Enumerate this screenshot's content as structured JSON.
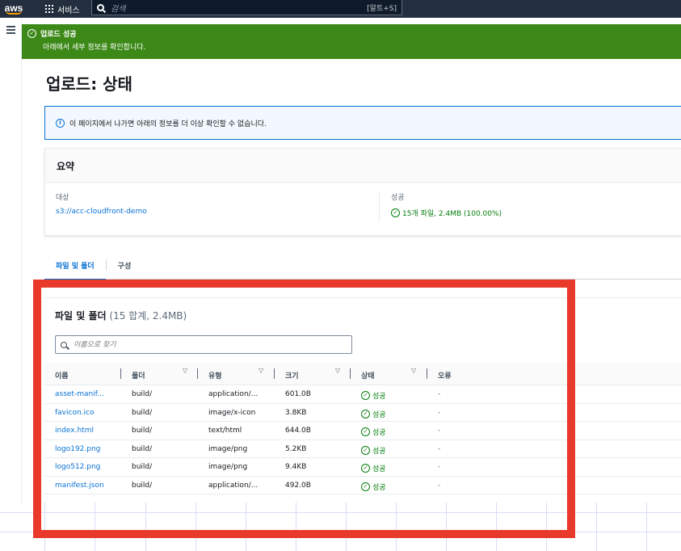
{
  "topbar": {
    "logo": "aws",
    "services_label": "서비스",
    "search_placeholder": "검색",
    "search_shortcut": "[알트+S]"
  },
  "flash": {
    "title": "업로드 성공",
    "message": "아래에서 세부 정보를 확인합니다.",
    "color": "#3c8918"
  },
  "page": {
    "title": "업로드: 상태"
  },
  "info": {
    "message": "이 페이지에서 나가면 아래의 정보를 더 이상 확인할 수 없습니다."
  },
  "summary": {
    "heading": "요약",
    "destination_label": "대상",
    "destination_value": "s3://acc-cloudfront-demo",
    "success_label": "성공",
    "success_value": "15개 파일, 2.4MB (100.00%)"
  },
  "tabs": [
    {
      "label": "파일 및 폴더"
    },
    {
      "label": "구성"
    }
  ],
  "files": {
    "heading": "파일 및 폴더",
    "count_text": "(15 합계, 2.4MB)",
    "filter_placeholder": "이름으로 찾기",
    "columns": [
      "이름",
      "폴더",
      "유형",
      "크기",
      "상태",
      "오류"
    ],
    "rows": [
      {
        "name": "asset-manif...",
        "folder": "build/",
        "type": "application/...",
        "size": "601.0B",
        "status": "성공",
        "error": "-"
      },
      {
        "name": "favicon.ico",
        "folder": "build/",
        "type": "image/x-icon",
        "size": "3.8KB",
        "status": "성공",
        "error": "-"
      },
      {
        "name": "index.html",
        "folder": "build/",
        "type": "text/html",
        "size": "644.0B",
        "status": "성공",
        "error": "-"
      },
      {
        "name": "logo192.png",
        "folder": "build/",
        "type": "image/png",
        "size": "5.2KB",
        "status": "성공",
        "error": "-"
      },
      {
        "name": "logo512.png",
        "folder": "build/",
        "type": "image/png",
        "size": "9.4KB",
        "status": "성공",
        "error": "-"
      },
      {
        "name": "manifest.json",
        "folder": "build/",
        "type": "application/...",
        "size": "492.0B",
        "status": "성공",
        "error": "-"
      }
    ]
  },
  "colors": {
    "accent": "#0972d3",
    "success": "#037f0c",
    "highlight": "#e8392a",
    "header": "#232f3e"
  }
}
